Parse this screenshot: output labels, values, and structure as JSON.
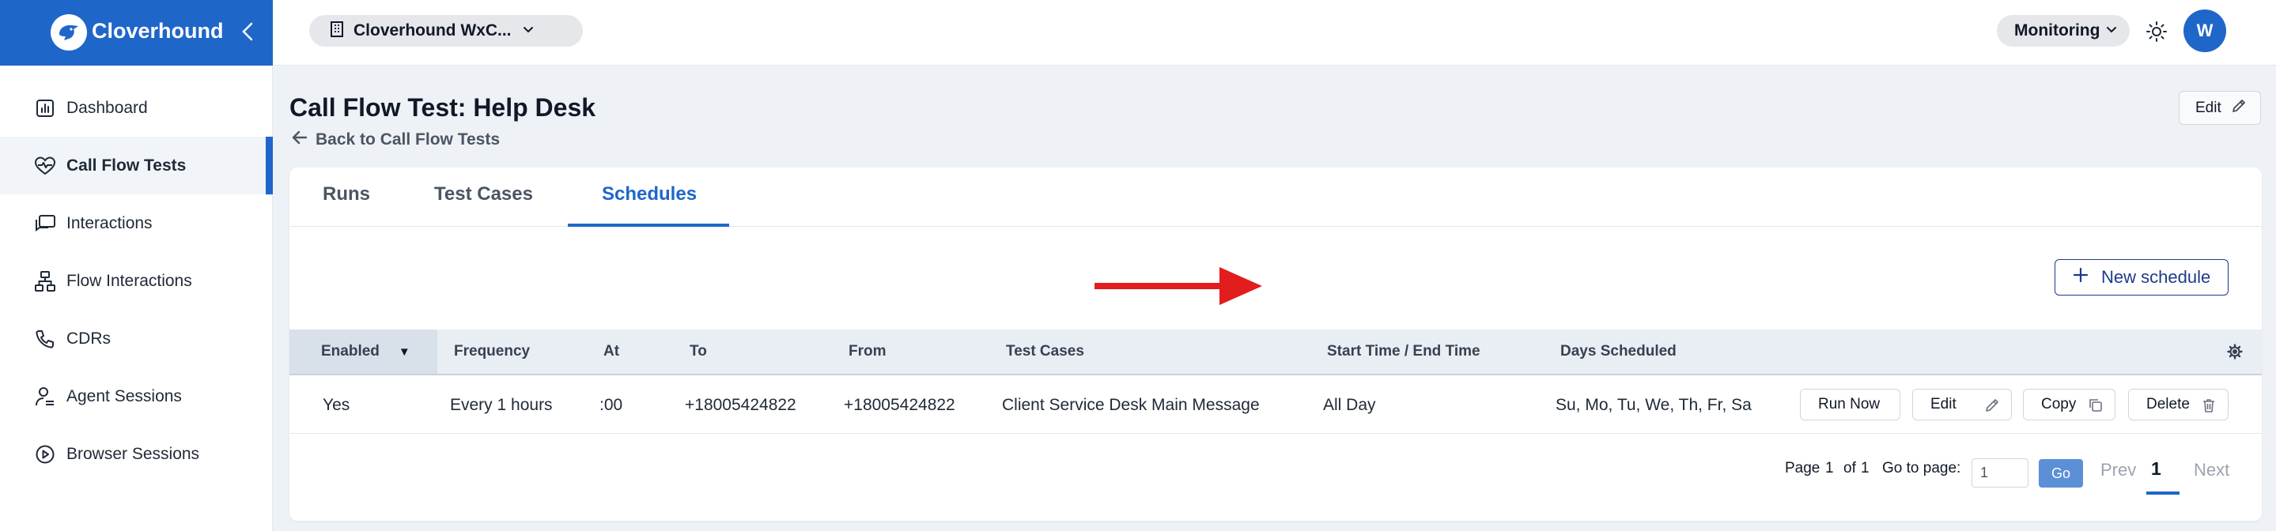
{
  "app": {
    "name": "Cloverhound",
    "colors": {
      "brand": "#1f66c9",
      "tab_active": "#1f66c9",
      "annotation_arrow": "#e11d1d"
    }
  },
  "sidebar": {
    "items": [
      {
        "label": "Dashboard",
        "icon": "chart-icon",
        "active": false
      },
      {
        "label": "Call Flow Tests",
        "icon": "heartbeat-icon",
        "active": true
      },
      {
        "label": "Interactions",
        "icon": "chat-icon",
        "active": false
      },
      {
        "label": "Flow Interactions",
        "icon": "flow-icon",
        "active": false
      },
      {
        "label": "CDRs",
        "icon": "phone-icon",
        "active": false
      },
      {
        "label": "Agent Sessions",
        "icon": "agent-icon",
        "active": false
      },
      {
        "label": "Browser Sessions",
        "icon": "play-circle-icon",
        "active": false
      }
    ]
  },
  "topbar": {
    "org": "Cloverhound WxC...",
    "mode": "Monitoring",
    "avatar_initial": "W"
  },
  "page": {
    "title": "Call Flow Test: Help Desk",
    "back_label": "Back to Call Flow Tests",
    "edit_label": "Edit"
  },
  "tabs": [
    {
      "label": "Runs",
      "active": false
    },
    {
      "label": "Test Cases",
      "active": false
    },
    {
      "label": "Schedules",
      "active": true
    }
  ],
  "new_schedule_label": "New schedule",
  "table": {
    "columns": [
      "Enabled",
      "Frequency",
      "At",
      "To",
      "From",
      "Test Cases",
      "Start Time / End Time",
      "Days Scheduled"
    ],
    "rows": [
      {
        "enabled": "Yes",
        "frequency": "Every 1 hours",
        "at": ":00",
        "to": "+18005424822",
        "from": "+18005424822",
        "test_cases": "Client Service Desk Main Message",
        "time": "All Day",
        "days": "Su, Mo, Tu, We, Th, Fr, Sa",
        "actions": {
          "run": "Run Now",
          "edit": "Edit",
          "copy": "Copy",
          "delete": "Delete"
        }
      }
    ]
  },
  "pagination": {
    "page_word": "Page",
    "current": "1",
    "of_word": "of",
    "total": "1",
    "goto_label": "Go to page:",
    "goto_value": "1",
    "go_label": "Go",
    "prev_label": "Prev",
    "next_label": "Next"
  }
}
